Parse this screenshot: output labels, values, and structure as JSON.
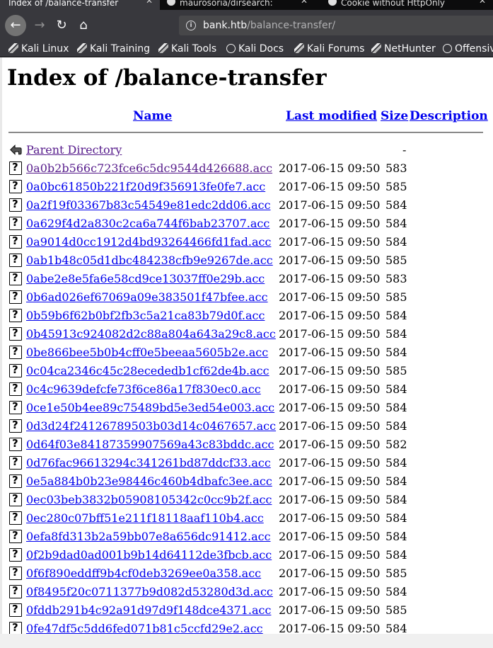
{
  "browser": {
    "tabs": [
      {
        "title": "Index of /balance-transfer",
        "active": true
      },
      {
        "title": "maurosoria/dirsearch:",
        "active": false
      },
      {
        "title": "Cookie without HttpOnly",
        "active": false
      }
    ],
    "url_host": "bank.htb",
    "url_path": "/balance-transfer/",
    "bookmarks": [
      "Kali Linux",
      "Kali Training",
      "Kali Tools",
      "Kali Docs",
      "Kali Forums",
      "NetHunter",
      "Offensive"
    ]
  },
  "page": {
    "title": "Index of /balance-transfer",
    "headers": {
      "name": "Name",
      "last_modified": "Last modified",
      "size": "Size",
      "description": "Description"
    },
    "parent": {
      "name": "Parent Directory",
      "size": "-"
    },
    "files": [
      {
        "name": "0a0b2b566c723fce6c5dc9544d426688.acc",
        "date": "2017-06-15 09:50",
        "size": "583"
      },
      {
        "name": "0a0bc61850b221f20d9f356913fe0fe7.acc",
        "date": "2017-06-15 09:50",
        "size": "585"
      },
      {
        "name": "0a2f19f03367b83c54549e81edc2dd06.acc",
        "date": "2017-06-15 09:50",
        "size": "584"
      },
      {
        "name": "0a629f4d2a830c2ca6a744f6bab23707.acc",
        "date": "2017-06-15 09:50",
        "size": "584"
      },
      {
        "name": "0a9014d0cc1912d4bd93264466fd1fad.acc",
        "date": "2017-06-15 09:50",
        "size": "584"
      },
      {
        "name": "0ab1b48c05d1dbc484238cfb9e9267de.acc",
        "date": "2017-06-15 09:50",
        "size": "585"
      },
      {
        "name": "0abe2e8e5fa6e58cd9ce13037ff0e29b.acc",
        "date": "2017-06-15 09:50",
        "size": "583"
      },
      {
        "name": "0b6ad026ef67069a09e383501f47bfee.acc",
        "date": "2017-06-15 09:50",
        "size": "585"
      },
      {
        "name": "0b59b6f62b0bf2fb3c5a21ca83b79d0f.acc",
        "date": "2017-06-15 09:50",
        "size": "584"
      },
      {
        "name": "0b45913c924082d2c88a804a643a29c8.acc",
        "date": "2017-06-15 09:50",
        "size": "584"
      },
      {
        "name": "0be866bee5b0b4cff0e5beeaa5605b2e.acc",
        "date": "2017-06-15 09:50",
        "size": "584"
      },
      {
        "name": "0c04ca2346c45c28ecededb1cf62de4b.acc",
        "date": "2017-06-15 09:50",
        "size": "585"
      },
      {
        "name": "0c4c9639defcfe73f6ce86a17f830ec0.acc",
        "date": "2017-06-15 09:50",
        "size": "584"
      },
      {
        "name": "0ce1e50b4ee89c75489bd5e3ed54e003.acc",
        "date": "2017-06-15 09:50",
        "size": "584"
      },
      {
        "name": "0d3d24f24126789503b03d14c0467657.acc",
        "date": "2017-06-15 09:50",
        "size": "584"
      },
      {
        "name": "0d64f03e84187359907569a43c83bddc.acc",
        "date": "2017-06-15 09:50",
        "size": "582"
      },
      {
        "name": "0d76fac96613294c341261bd87ddcf33.acc",
        "date": "2017-06-15 09:50",
        "size": "584"
      },
      {
        "name": "0e5a884b0b23e98446c460b4dbafc3ee.acc",
        "date": "2017-06-15 09:50",
        "size": "584"
      },
      {
        "name": "0ec03beb3832b05908105342c0cc9b2f.acc",
        "date": "2017-06-15 09:50",
        "size": "584"
      },
      {
        "name": "0ec280c07bff51e211f18118aaf110b4.acc",
        "date": "2017-06-15 09:50",
        "size": "584"
      },
      {
        "name": "0efa8fd313b2a59bb07e8a656dc91412.acc",
        "date": "2017-06-15 09:50",
        "size": "584"
      },
      {
        "name": "0f2b9dad0ad001b9b14d64112de3fbcb.acc",
        "date": "2017-06-15 09:50",
        "size": "584"
      },
      {
        "name": "0f6f890eddff9b4cf0deb3269ee0a358.acc",
        "date": "2017-06-15 09:50",
        "size": "585"
      },
      {
        "name": "0f8495f20c0711377b9d082d53280d3d.acc",
        "date": "2017-06-15 09:50",
        "size": "584"
      },
      {
        "name": "0fddb291b4c92a91d97d9f148dce4371.acc",
        "date": "2017-06-15 09:50",
        "size": "585"
      },
      {
        "name": "0fe47df5c5dd6fed071b81c5ccfd29e2.acc",
        "date": "2017-06-15 09:50",
        "size": "584"
      }
    ]
  }
}
